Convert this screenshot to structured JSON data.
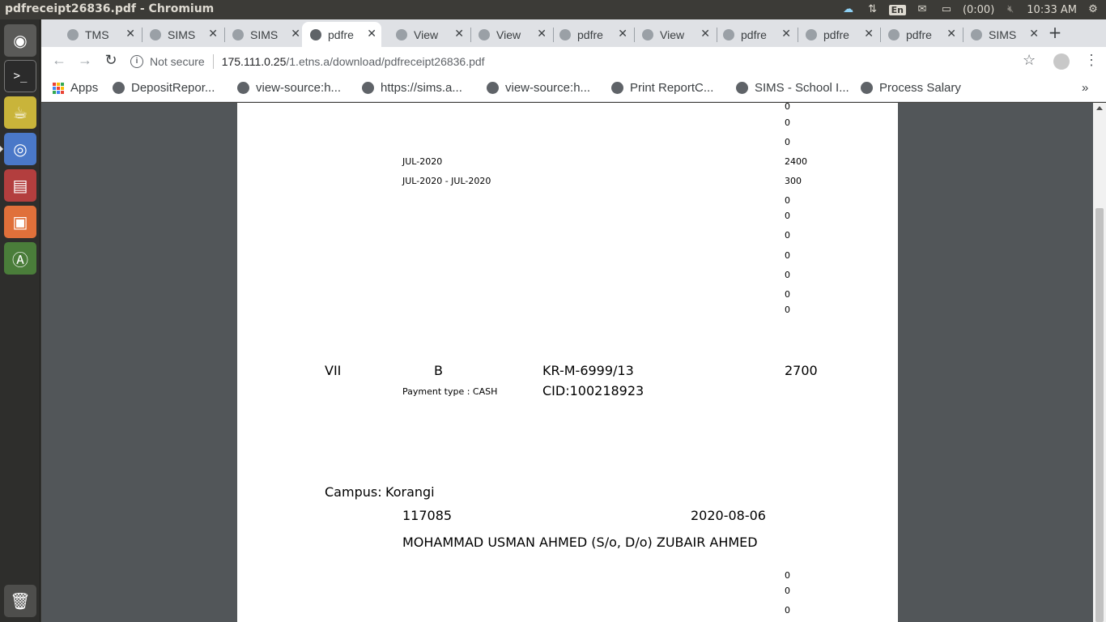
{
  "window": {
    "title": "pdfreceipt26836.pdf - Chromium",
    "tray": {
      "lang": "En",
      "battery": "(0:00)",
      "clock": "10:33 AM"
    }
  },
  "tabs": [
    {
      "label": "TMS"
    },
    {
      "label": "SIMS"
    },
    {
      "label": "SIMS"
    },
    {
      "label": "pdfre"
    },
    {
      "label": "View"
    },
    {
      "label": "View"
    },
    {
      "label": "pdfre"
    },
    {
      "label": "View"
    },
    {
      "label": "pdfre"
    },
    {
      "label": "pdfre"
    },
    {
      "label": "pdfre"
    },
    {
      "label": "SIMS"
    }
  ],
  "active_tab": 3,
  "toolbar": {
    "security_label": "Not secure",
    "url_host": "175.111.0.25",
    "url_path": "/1.etns.a/download/pdfreceipt26836.pdf"
  },
  "bookmarks": {
    "apps_label": "Apps",
    "items": [
      {
        "label": "DepositRepor..."
      },
      {
        "label": "view-source:h..."
      },
      {
        "label": "https://sims.a..."
      },
      {
        "label": "view-source:h..."
      },
      {
        "label": "Print ReportC..."
      },
      {
        "label": "SIMS - School I..."
      },
      {
        "label": "Process Salary"
      }
    ],
    "overflow": "»"
  },
  "pdf": {
    "upper_amounts": [
      "0",
      "0",
      "0"
    ],
    "fee_lines": [
      {
        "period": "JUL-2020",
        "amount": "2400"
      },
      {
        "period": "JUL-2020 - JUL-2020",
        "amount": "300"
      }
    ],
    "lower_amounts": [
      "0",
      "0",
      "0",
      "0",
      "0",
      "0",
      "0"
    ],
    "summary": {
      "class": "VII",
      "section": "B",
      "gr_no": "KR-M-6999/13",
      "total": "2700",
      "payment_type": "Payment type : CASH",
      "cid": "CID:100218923"
    },
    "next_receipt": {
      "campus_label": "Campus:",
      "campus": "Korangi",
      "receipt_no": "117085",
      "date": "2020-08-06",
      "student": "MOHAMMAD USMAN AHMED (S/o, D/o) ZUBAIR AHMED",
      "amounts": [
        "0",
        "0",
        "0"
      ]
    }
  }
}
